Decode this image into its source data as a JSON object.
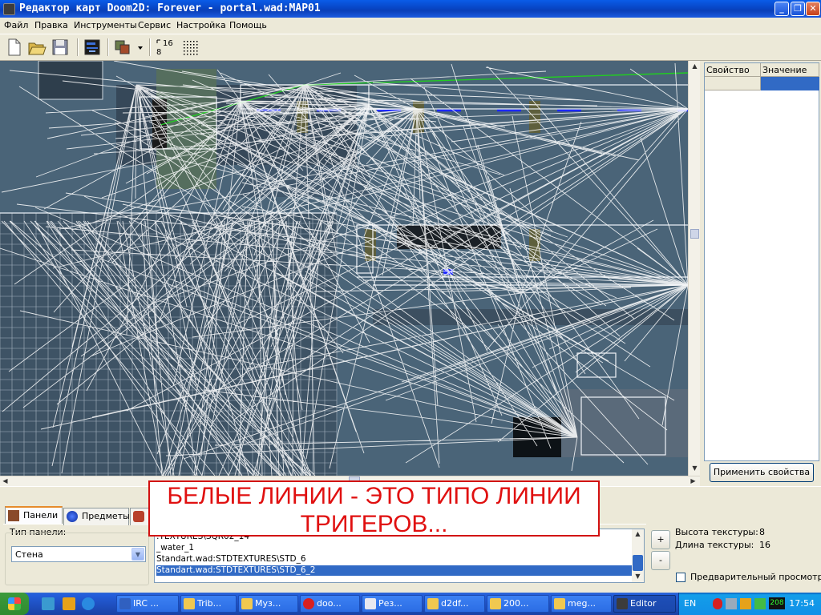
{
  "window": {
    "title": "Редактор карт Doom2D: Forever - portal.wad:MAP01",
    "controls": [
      "_",
      "❐",
      "✕"
    ]
  },
  "menu": [
    "Файл",
    "Правка",
    "Инструменты",
    "Сервис",
    "Настройка",
    "Помощь"
  ],
  "toolbar": {
    "tools": [
      "new-file-icon",
      "open-folder-icon",
      "save-icon",
      "minimap-icon",
      "layers-icon",
      "dropdown-arrow-icon",
      "grid-step-icon",
      "grid-dots-icon"
    ],
    "grid_top": "16",
    "grid_bottom": "8"
  },
  "properties": {
    "col_property": "Свойство",
    "col_value": "Значение",
    "apply_button": "Применить свойства"
  },
  "annotation": {
    "line1": "БЕЛЫЕ ЛИНИИ - ЭТО ТИПО ЛИНИИ",
    "line2": "ТРИГЕРОВ..."
  },
  "bottom": {
    "tabs": [
      "Панели",
      "Предметы"
    ],
    "panel_type_label": "Тип панели:",
    "panel_type_value": "Стена",
    "textures": [
      ":TEXTURES\\SQR02_14",
      "_water_1",
      "Standart.wad:STDTEXTURES\\STD_6",
      "Standart.wad:STDTEXTURES\\STD_6_2"
    ],
    "selected_texture_index": 3,
    "add_label": "+",
    "remove_label": "-",
    "tex_height_label": "Высота текстуры:",
    "tex_height_value": "8",
    "tex_width_label": "Длина текстуры:",
    "tex_width_value": "16",
    "preview_label": "Предварительный просмотр"
  },
  "taskbar": {
    "items": [
      "IRC ...",
      "Trib...",
      "Муз...",
      "doo...",
      "Рез...",
      "d2df...",
      "200...",
      "meg...",
      "Editor"
    ],
    "lang": "EN",
    "tray_badge": "208",
    "clock": "17:54"
  },
  "colors": {
    "titlebar": "#0a5ce8",
    "map_bg": "#4a6478",
    "annotation_red": "#e01010",
    "selection": "#316ac5"
  }
}
